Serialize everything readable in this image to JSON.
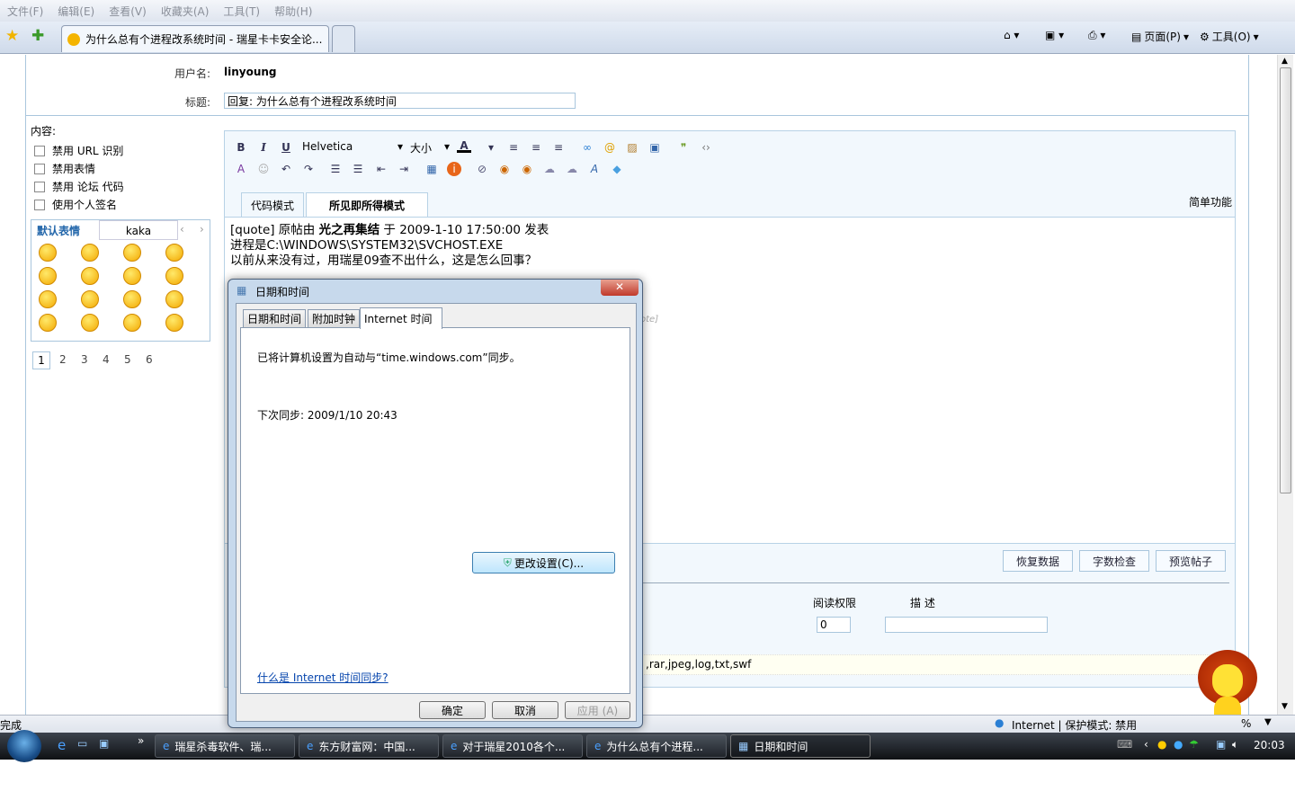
{
  "menu": [
    "文件(F)",
    "编辑(E)",
    "查看(V)",
    "收藏夹(A)",
    "工具(T)",
    "帮助(H)"
  ],
  "browser": {
    "tab_title": "为什么总有个进程改系统时间 - 瑞星卡卡安全论...",
    "page_label": "页面(P)",
    "tools_label": "工具(O)"
  },
  "form": {
    "username_label": "用户名:",
    "username": "linyoung",
    "title_label": "标题:",
    "title_value": "回复: 为什么总有个进程改系统时间",
    "content_label": "内容:",
    "options": [
      "禁用 URL 识别",
      "禁用表情",
      "禁用 论坛 代码",
      "使用个人签名"
    ]
  },
  "smilies": {
    "tabs": [
      "默认表情",
      "kaka"
    ],
    "pages": [
      "1",
      "2",
      "3",
      "4",
      "5",
      "6"
    ],
    "current_page": "1"
  },
  "editor": {
    "font": "Helvetica",
    "size": "大小",
    "tabs": [
      "代码模式",
      "所见即所得模式"
    ],
    "active_tab": "所见即所得模式",
    "simple": "简单功能",
    "lines": [
      "[quote] 原帖由 ",
      "光之再集结",
      " 于 2009-1-10 17:50:00 发表",
      "进程是C:\\WINDOWS\\SYSTEM32\\SVCHOST.EXE",
      "以前从来没有过，用瑞星09查不出什么，这是怎么回事？"
    ],
    "quote_end": "ote]"
  },
  "buttons": {
    "restore": "恢复数据",
    "count": "字数检查",
    "preview": "预览帖子"
  },
  "attach": {
    "perm_label": "阅读权限",
    "desc_label": "描 述",
    "perm_value": "0",
    "types": ",rar,jpeg,log,txt,swf"
  },
  "dialog": {
    "title": "日期和时间",
    "tabs": [
      "日期和时间",
      "附加时钟",
      "Internet 时间"
    ],
    "active_tab": "Internet 时间",
    "sync_text": "已将计算机设置为自动与“time.windows.com”同步。",
    "next_sync": "下次同步: 2009/1/10 20:43",
    "change_button": "更改设置(C)...",
    "link": "什么是 Internet 时间同步?",
    "ok": "确定",
    "cancel": "取消",
    "apply": "应用 (A)"
  },
  "status": {
    "left": "完成",
    "zone": "Internet | 保护模式: 禁用",
    "zoom": "%"
  },
  "taskbar": {
    "tasks": [
      "瑞星杀毒软件、瑞...",
      "东方财富网：中国...",
      "对于瑞星2010各个...",
      "为什么总有个进程...",
      "日期和时间"
    ],
    "active_task": 4,
    "clock": "20:03",
    "more": "»"
  }
}
